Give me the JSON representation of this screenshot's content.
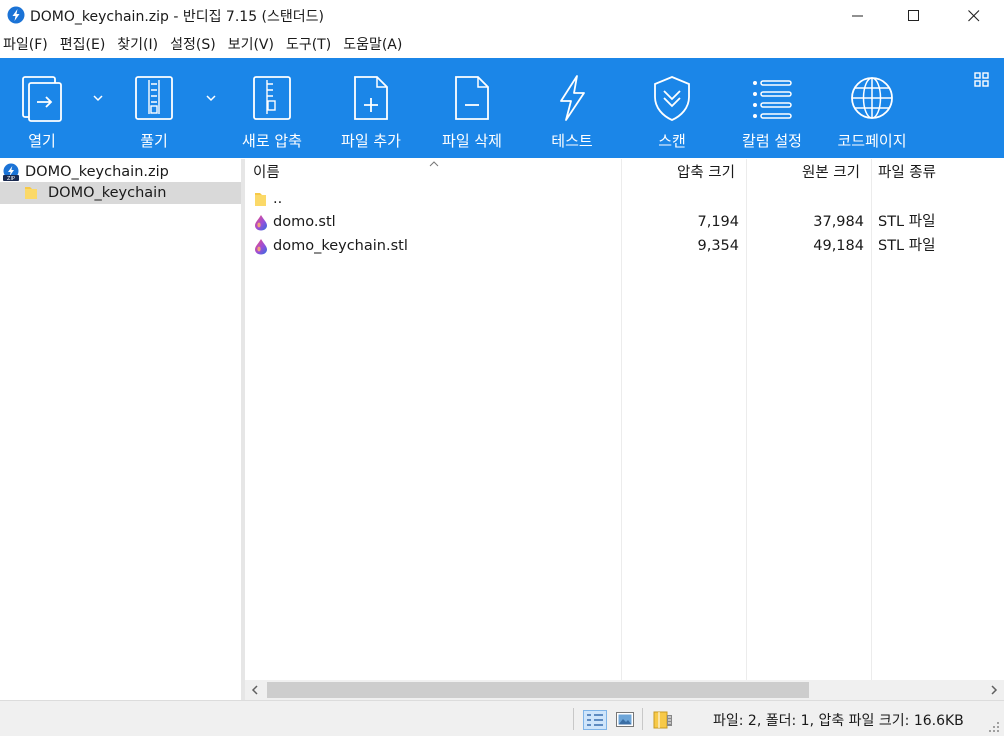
{
  "window": {
    "title": "DOMO_keychain.zip - 반디집 7.15 (스탠더드)"
  },
  "menu": [
    {
      "label": "파일(F)"
    },
    {
      "label": "편집(E)"
    },
    {
      "label": "찾기(I)"
    },
    {
      "label": "설정(S)"
    },
    {
      "label": "보기(V)"
    },
    {
      "label": "도구(T)"
    },
    {
      "label": "도움말(A)"
    }
  ],
  "toolbar": {
    "open": "열기",
    "extract": "풀기",
    "new_archive": "새로 압축",
    "add_file": "파일 추가",
    "delete_file": "파일 삭제",
    "test": "테스트",
    "scan": "스캔",
    "columns": "칼럼 설정",
    "codepage": "코드페이지"
  },
  "tree": {
    "root": "DOMO_keychain.zip",
    "child": "DOMO_keychain"
  },
  "columns": {
    "name": "이름",
    "packed": "압축 크기",
    "original": "원본 크기",
    "type": "파일 종류"
  },
  "rows": [
    {
      "name": "..",
      "packed": "",
      "original": "",
      "type": ""
    },
    {
      "name": "domo.stl",
      "packed": "7,194",
      "original": "37,984",
      "type": "STL 파일"
    },
    {
      "name": "domo_keychain.stl",
      "packed": "9,354",
      "original": "49,184",
      "type": "STL 파일"
    }
  ],
  "status": {
    "summary": "파일: 2, 폴더: 1, 압축 파일 크기: 16.6KB"
  },
  "colors": {
    "toolbar": "#1b86e8",
    "selection": "#d9d9d9",
    "folder": "#f7c948"
  }
}
